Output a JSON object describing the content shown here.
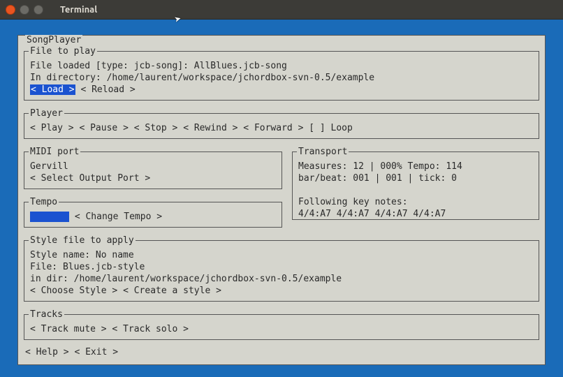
{
  "window": {
    "title": "Terminal"
  },
  "app": {
    "title": "SongPlayer"
  },
  "file": {
    "legend": "File to play",
    "loaded_line": "File loaded [type: jcb-song]: AllBlues.jcb-song",
    "dir_line": "In directory: /home/laurent/workspace/jchordbox-svn-0.5/example",
    "load": "< Load >",
    "reload": "< Reload >"
  },
  "player": {
    "legend": "Player",
    "play": "< Play >",
    "pause": "< Pause >",
    "stop": "< Stop >",
    "rewind": "< Rewind >",
    "forward": "< Forward >",
    "loop": "[ ] Loop"
  },
  "midi": {
    "legend": "MIDI port",
    "device": "Gervill",
    "select": "< Select Output Port >"
  },
  "transport": {
    "legend": "Transport",
    "line1": "Measures: 12  | 000% Tempo: 114",
    "line2": "bar/beat: 001 | 001 | tick: 0",
    "following": "Following key notes:",
    "notes": " 4/4:A7 4/4:A7 4/4:A7 4/4:A7"
  },
  "tempo": {
    "legend": "Tempo",
    "change": "< Change Tempo >"
  },
  "style": {
    "legend": "Style file to apply",
    "name_line": "Style name: No name",
    "file_line": "File: Blues.jcb-style",
    "dir_line": "in dir: /home/laurent/workspace/jchordbox-svn-0.5/example",
    "choose": "< Choose Style >",
    "create": "< Create a style >"
  },
  "tracks": {
    "legend": "Tracks",
    "mute": "< Track mute >",
    "solo": "< Track solo >"
  },
  "footer": {
    "help": "< Help >",
    "exit": "< Exit >"
  }
}
